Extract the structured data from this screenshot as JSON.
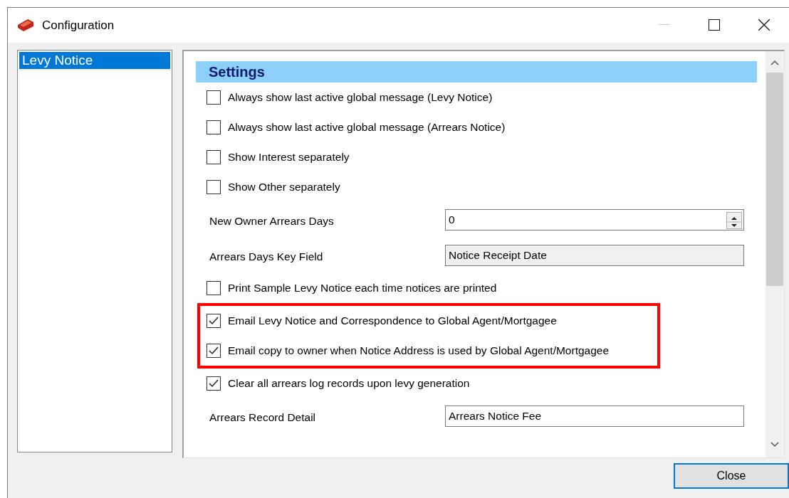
{
  "window": {
    "title": "Configuration"
  },
  "sidebar": {
    "items": [
      {
        "label": "Levy Notice",
        "selected": true
      }
    ]
  },
  "settings": {
    "title": "Settings",
    "items": [
      {
        "kind": "checkbox",
        "label": "Always show last active global message (Levy Notice)",
        "checked": false,
        "highlighted": false
      },
      {
        "kind": "checkbox",
        "label": "Always show last active global message (Arrears Notice)",
        "checked": false,
        "highlighted": false
      },
      {
        "kind": "checkbox",
        "label": "Show Interest separately",
        "checked": false,
        "highlighted": false
      },
      {
        "kind": "checkbox",
        "label": "Show Other separately",
        "checked": false,
        "highlighted": false
      },
      {
        "kind": "spin",
        "label": "New Owner Arrears Days",
        "value": "0"
      },
      {
        "kind": "readonly",
        "label": "Arrears Days Key Field",
        "value": "Notice Receipt Date"
      },
      {
        "kind": "checkbox",
        "label": "Print Sample Levy Notice each time notices are printed",
        "checked": false,
        "highlighted": false
      },
      {
        "kind": "checkbox",
        "label": "Email Levy Notice and Correspondence to Global Agent/Mortgagee",
        "checked": true,
        "highlighted": true
      },
      {
        "kind": "checkbox",
        "label": "Email copy to owner when Notice Address is used by Global Agent/Mortgagee",
        "checked": true,
        "highlighted": true
      },
      {
        "kind": "checkbox",
        "label": "Clear all arrears log records upon levy generation",
        "checked": true,
        "highlighted": false
      },
      {
        "kind": "text",
        "label": "Arrears Record Detail",
        "value": "Arrears Notice Fee"
      }
    ]
  },
  "buttons": [
    {
      "label": "Close",
      "default": true
    }
  ]
}
